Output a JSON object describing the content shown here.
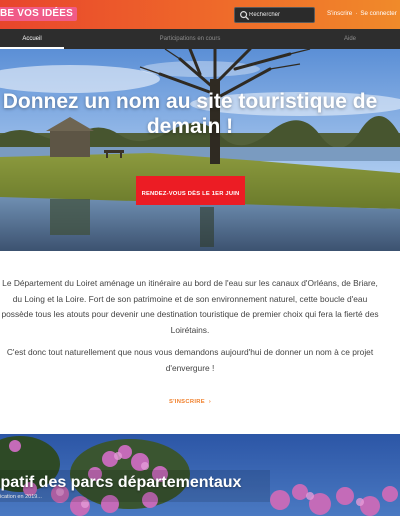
{
  "header": {
    "logo_text": "BE VOS IDÉES",
    "search_placeholder": "Rechercher",
    "signup_label": "S'inscrire",
    "separator": "·",
    "login_label": "Se connecter"
  },
  "nav": {
    "tabs": [
      {
        "label": "Accueil",
        "active": true
      },
      {
        "label": "Participations en cours",
        "active": false
      },
      {
        "label": "Aide",
        "active": false
      }
    ]
  },
  "hero": {
    "title": "Donnez un nom au site touristique de demain !",
    "cta_label": "RENDEZ-VOUS DÈS LE 1ER JUIN"
  },
  "intro": {
    "paragraph1": "Le Département du Loiret aménage un itinéraire au bord de l'eau sur les canaux d'Orléans, de Briare, du Loing et la Loire. Fort de son patrimoine et de son environnement naturel, cette boucle d'eau possède tous les atouts pour devenir une destination touristique de premier choix qui fera la fierté des Loirétains.",
    "paragraph2": "C'est donc tout naturellement que nous vous demandons aujourd'hui de donner un nom à ce projet d'envergure !",
    "signup_link": "S'INSCRIRE",
    "signup_chevron": "›"
  },
  "card": {
    "title": "ipatif des parcs départementaux",
    "subtitle": "ication en 2019..."
  },
  "colors": {
    "header_start": "#e8452c",
    "header_end": "#f08a2a",
    "logo_bg": "#f05b88",
    "nav_bg": "#2d2d2d",
    "cta_bg": "#ec1c24",
    "link_orange": "#f07f2a"
  },
  "icons": {
    "search": "search-icon",
    "chevron": "chevron-right-icon"
  }
}
